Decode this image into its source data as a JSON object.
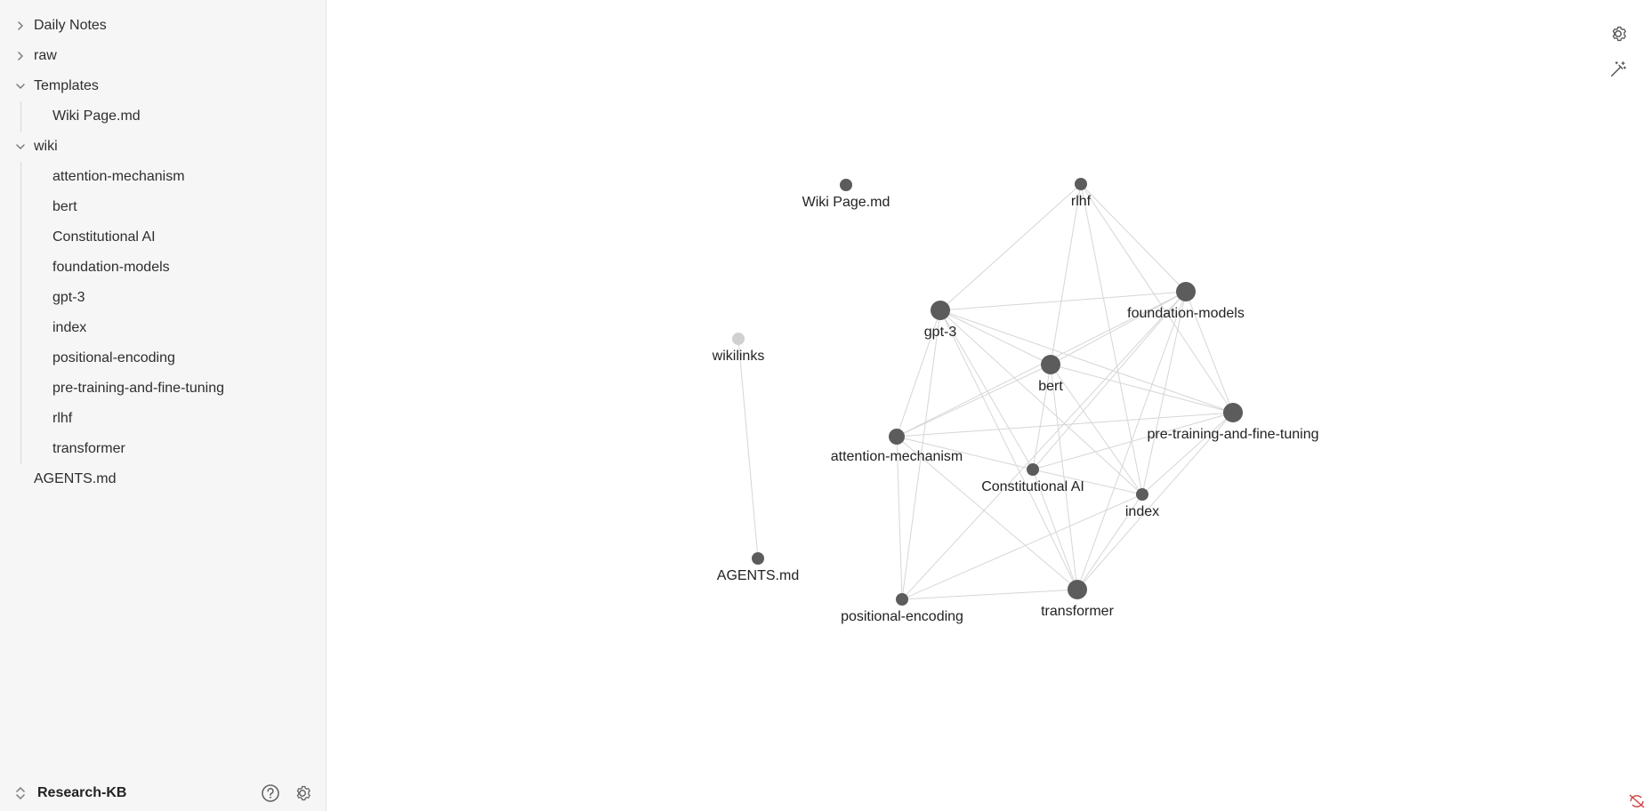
{
  "vault": {
    "name": "Research-KB"
  },
  "tree": {
    "folders": [
      {
        "label": "Daily Notes",
        "expanded": false
      },
      {
        "label": "raw",
        "expanded": false
      },
      {
        "label": "Templates",
        "expanded": true,
        "children": [
          "Wiki Page.md"
        ]
      },
      {
        "label": "wiki",
        "expanded": true,
        "children": [
          "attention-mechanism",
          "bert",
          "Constitutional AI",
          "foundation-models",
          "gpt-3",
          "index",
          "positional-encoding",
          "pre-training-and-fine-tuning",
          "rlhf",
          "transformer"
        ]
      }
    ],
    "root_files": [
      "AGENTS.md"
    ]
  },
  "icons": {
    "help": "help-circle-icon",
    "settings": "gear-icon",
    "graph_settings": "gear-icon",
    "graph_animate": "magic-wand-icon",
    "vault_switch": "chevrons-up-down-icon",
    "chevron_right": "chevron-right-icon",
    "chevron_down": "chevron-down-icon"
  },
  "colors": {
    "node": "#5c5c5c",
    "unresolved_node": "#d0d0d0",
    "edge": "#d6d6d6",
    "sidebar_bg": "#f6f6f6"
  },
  "graph": {
    "nodes": [
      {
        "id": "wiki-page",
        "label": "Wiki Page.md",
        "size": "small"
      },
      {
        "id": "rlhf",
        "label": "rlhf",
        "size": "small"
      },
      {
        "id": "foundation-models",
        "label": "foundation-models",
        "size": "large"
      },
      {
        "id": "gpt-3",
        "label": "gpt-3",
        "size": "large"
      },
      {
        "id": "wikilinks",
        "label": "wikilinks",
        "size": "small",
        "unresolved": true
      },
      {
        "id": "bert",
        "label": "bert",
        "size": "large"
      },
      {
        "id": "pre-training",
        "label": "pre-training-and-fine-tuning",
        "size": "large"
      },
      {
        "id": "attention",
        "label": "attention-mechanism",
        "size": "medium"
      },
      {
        "id": "constitutional",
        "label": "Constitutional AI",
        "size": "small"
      },
      {
        "id": "index",
        "label": "index",
        "size": "small"
      },
      {
        "id": "agents",
        "label": "AGENTS.md",
        "size": "small"
      },
      {
        "id": "transformer",
        "label": "transformer",
        "size": "large"
      },
      {
        "id": "positional",
        "label": "positional-encoding",
        "size": "small"
      }
    ],
    "edges": [
      [
        "wikilinks",
        "agents"
      ],
      [
        "rlhf",
        "gpt-3"
      ],
      [
        "rlhf",
        "foundation-models"
      ],
      [
        "rlhf",
        "bert"
      ],
      [
        "rlhf",
        "pre-training"
      ],
      [
        "rlhf",
        "index"
      ],
      [
        "gpt-3",
        "foundation-models"
      ],
      [
        "gpt-3",
        "bert"
      ],
      [
        "gpt-3",
        "pre-training"
      ],
      [
        "gpt-3",
        "attention"
      ],
      [
        "gpt-3",
        "constitutional"
      ],
      [
        "gpt-3",
        "index"
      ],
      [
        "gpt-3",
        "positional"
      ],
      [
        "gpt-3",
        "transformer"
      ],
      [
        "foundation-models",
        "bert"
      ],
      [
        "foundation-models",
        "pre-training"
      ],
      [
        "foundation-models",
        "attention"
      ],
      [
        "foundation-models",
        "constitutional"
      ],
      [
        "foundation-models",
        "index"
      ],
      [
        "foundation-models",
        "transformer"
      ],
      [
        "foundation-models",
        "positional"
      ],
      [
        "bert",
        "pre-training"
      ],
      [
        "bert",
        "attention"
      ],
      [
        "bert",
        "constitutional"
      ],
      [
        "bert",
        "index"
      ],
      [
        "bert",
        "transformer"
      ],
      [
        "pre-training",
        "attention"
      ],
      [
        "pre-training",
        "constitutional"
      ],
      [
        "pre-training",
        "index"
      ],
      [
        "pre-training",
        "transformer"
      ],
      [
        "attention",
        "constitutional"
      ],
      [
        "attention",
        "positional"
      ],
      [
        "attention",
        "transformer"
      ],
      [
        "constitutional",
        "transformer"
      ],
      [
        "constitutional",
        "index"
      ],
      [
        "index",
        "transformer"
      ],
      [
        "index",
        "positional"
      ],
      [
        "positional",
        "transformer"
      ]
    ]
  }
}
